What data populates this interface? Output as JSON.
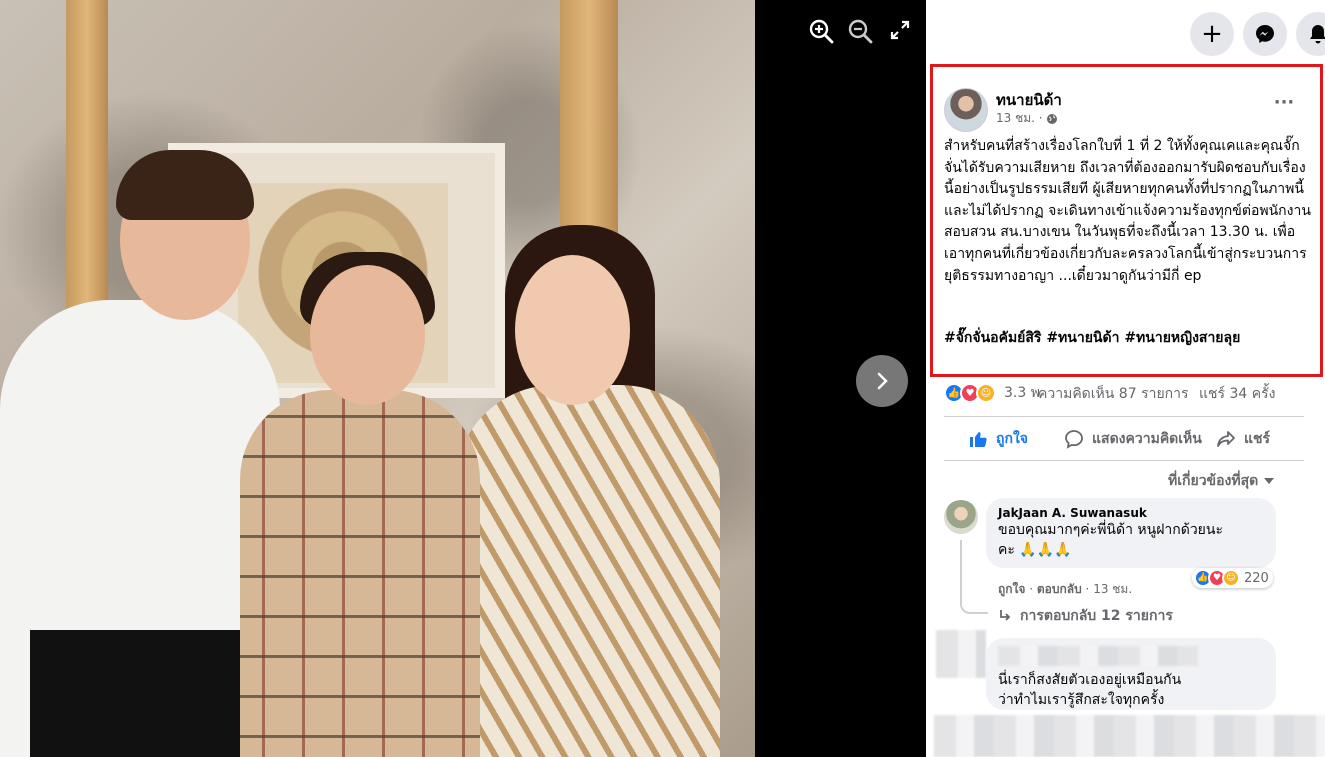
{
  "viewer": {
    "zoom_in_icon": "zoom-in-icon",
    "zoom_out_icon": "zoom-out-icon",
    "fullscreen_icon": "fullscreen-icon",
    "next_icon": "chevron-right-icon"
  },
  "topbar": {
    "create_icon": "+",
    "messenger_icon": "messenger-icon",
    "notifications_icon": "bell-icon"
  },
  "post": {
    "author": "ทนายนิด้า",
    "time": "13 ชม. ·",
    "privacy_icon": "globe-icon",
    "more_label": "···",
    "text": "สำหรับคนที่สร้างเรื่องโลกใบที่ 1 ที่ 2 ให้ทั้งคุณเคและคุณจั๊กจั่นได้รับความเสียหาย ถึงเวลาที่ต้องออกมารับผิดชอบกับเรื่องนี้อย่างเป็นรูปธรรมเสียที ผู้เสียหายทุกคนทั้งที่ปรากฏในภาพนี้และไม่ได้ปรากฏ จะเดินทางเข้าแจ้งความร้องทุกข์ต่อพนักงานสอบสวน สน.บางเขน ในวันพุธที่จะถึงนี้เวลา 13.30 น. เพื่อเอาทุกคนที่เกี่ยวข้องเกี่ยวกับละครลวงโลกนี้เข้าสู่กระบวนการยุติธรรมทางอาญา ...เดี๋ยวมาดูกันว่ามีกี่ ep",
    "hashtags": "#จั๊กจั่นอคัมย์สิริ #ทนายนิด้า #ทนายหญิงสายลุย",
    "highlight_color": "#e0161b"
  },
  "stats": {
    "reactions": "3.3 พ",
    "comments": "ความคิดเห็น 87 รายการ",
    "shares": "แชร์ 34 ครั้ง"
  },
  "actions": {
    "like": "ถูกใจ",
    "comment": "แสดงความคิดเห็น",
    "share": "แชร์",
    "like_color": "#1877f2"
  },
  "sort": {
    "label": "ที่เกี่ยวข้องที่สุด"
  },
  "comments": [
    {
      "name": "JakJaan A. Suwanasuk",
      "text_line1": "ขอบคุณมากๆค่ะพี่นิด้า หนูฝากด้วยนะ",
      "text_line2": "คะ 🙏🙏🙏",
      "like": "ถูกใจ",
      "reply": "ตอบกลับ",
      "time": "13 ชม.",
      "reaction_count": "220",
      "replies": "การตอบกลับ 12 รายการ"
    },
    {
      "text_line1": "นี่เราก็สงสัยตัวเองอยู่เหมือนกัน",
      "text_line2": "ว่าทำไมเรารู้สึกสะใจทุกครั้ง"
    }
  ]
}
